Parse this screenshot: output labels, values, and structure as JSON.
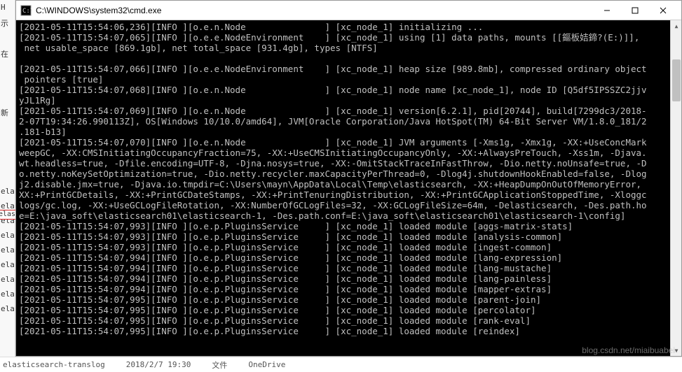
{
  "window": {
    "title": "C:\\WINDOWS\\system32\\cmd.exe"
  },
  "left_labels": [
    "H",
    "示",
    "在",
    "新",
    "elas",
    "elas",
    "elas",
    "elas",
    "elas",
    "elas",
    "elas",
    "elas",
    "elas"
  ],
  "red_label": "elas",
  "log_lines": [
    "[2021-05-11T15:54:06,236][INFO ][o.e.n.Node               ] [xc_node_1] initializing ...",
    "[2021-05-11T15:54:07,065][INFO ][o.e.e.NodeEnvironment    ] [xc_node_1] using [1] data paths, mounts [[鏂板姞鍗?(E:)]],",
    " net usable_space [869.1gb], net total_space [931.4gb], types [NTFS]",
    "",
    "[2021-05-11T15:54:07,066][INFO ][o.e.e.NodeEnvironment    ] [xc_node_1] heap size [989.8mb], compressed ordinary object",
    " pointers [true]",
    "[2021-05-11T15:54:07,068][INFO ][o.e.n.Node               ] [xc_node_1] node name [xc_node_1], node ID [Q5df5IPSSZC2jjv",
    "yJL1Rg]",
    "[2021-05-11T15:54:07,069][INFO ][o.e.n.Node               ] [xc_node_1] version[6.2.1], pid[20744], build[7299dc3/2018-",
    "2-07T19:34:26.990113Z], OS[Windows 10/10.0/amd64], JVM[Oracle Corporation/Java HotSpot(TM) 64-Bit Server VM/1.8.0_181/2",
    ".181-b13]",
    "[2021-05-11T15:54:07,070][INFO ][o.e.n.Node               ] [xc_node_1] JVM arguments [-Xms1g, -Xmx1g, -XX:+UseConcMark",
    "weepGC, -XX:CMSInitiatingOccupancyFraction=75, -XX:+UseCMSInitiatingOccupancyOnly, -XX:+AlwaysPreTouch, -Xss1m, -Djava.",
    "wt.headless=true, -Dfile.encoding=UTF-8, -Djna.nosys=true, -XX:-OmitStackTraceInFastThrow, -Dio.netty.noUnsafe=true, -D",
    "o.netty.noKeySetOptimization=true, -Dio.netty.recycler.maxCapacityPerThread=0, -Dlog4j.shutdownHookEnabled=false, -Dlog",
    "j2.disable.jmx=true, -Djava.io.tmpdir=C:\\Users\\mayn\\AppData\\Local\\Temp\\elasticsearch, -XX:+HeapDumpOnOutOfMemoryError,",
    "XX:+PrintGCDetails, -XX:+PrintGCDateStamps, -XX:+PrintTenuringDistribution, -XX:+PrintGCApplicationStoppedTime, -Xloggc",
    "logs/gc.log, -XX:+UseGCLogFileRotation, -XX:NumberOfGCLogFiles=32, -XX:GCLogFileSize=64m, -Delasticsearch, -Des.path.ho",
    "e=E:\\java_soft\\elasticsearch01\\elasticsearch-1, -Des.path.conf=E:\\java_soft\\elasticsearch01\\elasticsearch-1\\config]",
    "[2021-05-11T15:54:07,993][INFO ][o.e.p.PluginsService     ] [xc_node_1] loaded module [aggs-matrix-stats]",
    "[2021-05-11T15:54:07,993][INFO ][o.e.p.PluginsService     ] [xc_node_1] loaded module [analysis-common]",
    "[2021-05-11T15:54:07,993][INFO ][o.e.p.PluginsService     ] [xc_node_1] loaded module [ingest-common]",
    "[2021-05-11T15:54:07,994][INFO ][o.e.p.PluginsService     ] [xc_node_1] loaded module [lang-expression]",
    "[2021-05-11T15:54:07,994][INFO ][o.e.p.PluginsService     ] [xc_node_1] loaded module [lang-mustache]",
    "[2021-05-11T15:54:07,994][INFO ][o.e.p.PluginsService     ] [xc_node_1] loaded module [lang-painless]",
    "[2021-05-11T15:54:07,994][INFO ][o.e.p.PluginsService     ] [xc_node_1] loaded module [mapper-extras]",
    "[2021-05-11T15:54:07,995][INFO ][o.e.p.PluginsService     ] [xc_node_1] loaded module [parent-join]",
    "[2021-05-11T15:54:07,995][INFO ][o.e.p.PluginsService     ] [xc_node_1] loaded module [percolator]",
    "[2021-05-11T15:54:07,995][INFO ][o.e.p.PluginsService     ] [xc_node_1] loaded module [rank-eval]",
    "[2021-05-11T15:54:07,995][INFO ][o.e.p.PluginsService     ] [xc_node_1] loaded module [reindex]"
  ],
  "bottom": {
    "filename": "elasticsearch-translog",
    "date": "2018/2/7 19:30",
    "type": "文件",
    "onedrive": "OneDrive"
  },
  "watermark": "blog.csdn.net/miaibuabei"
}
